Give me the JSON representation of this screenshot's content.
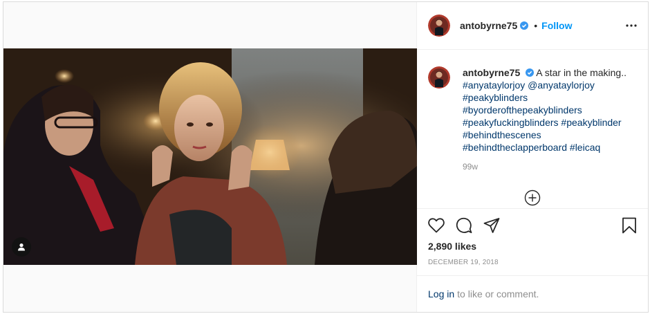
{
  "post": {
    "username": "antobyrne75",
    "follow_label": "Follow",
    "separator": "•",
    "caption": {
      "text": "A star in the making..",
      "tag_lines": [
        [
          "#anyataylorjoy",
          "@anyataylorjoy"
        ],
        [
          "#peakyblinders"
        ],
        [
          "#byorderofthepeakyblinders"
        ],
        [
          "#peakyfuckingblinders",
          "#peakyblinder"
        ],
        [
          "#behindthescenes"
        ],
        [
          "#behindtheclapperboard",
          "#leicaq"
        ]
      ]
    },
    "time_ago": "99w",
    "likes": "2,890 likes",
    "date": "DECEMBER 19, 2018",
    "login_link": "Log in",
    "login_suffix": "to like or comment."
  },
  "icons": {
    "verified": "verified-badge-icon",
    "more": "more-options-icon",
    "load_more": "load-more-comments-icon",
    "like": "heart-icon",
    "comment": "comment-icon",
    "share": "share-icon",
    "save": "bookmark-icon",
    "tag": "tagged-user-icon"
  },
  "colors": {
    "link_blue": "#0095f6",
    "tag_blue": "#00376b",
    "muted": "#8e8e8e",
    "border": "#dbdbdb"
  }
}
